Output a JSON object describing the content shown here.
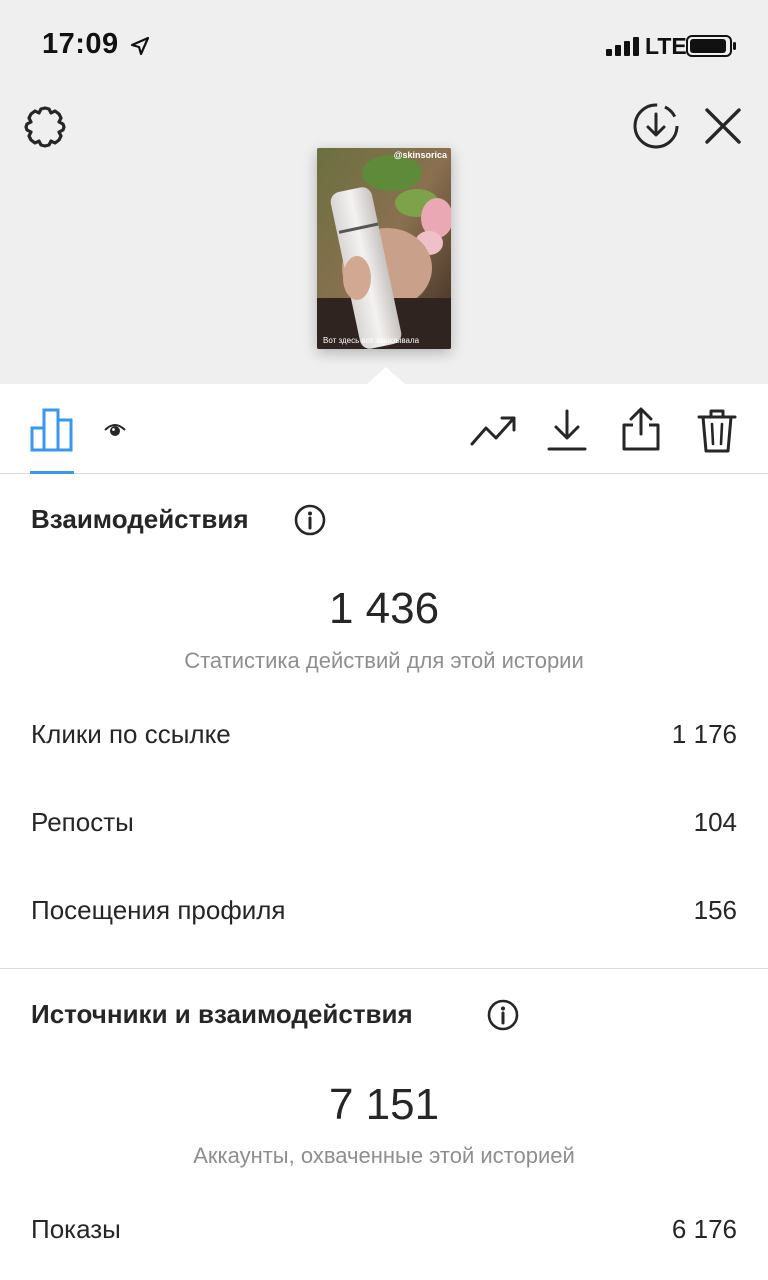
{
  "status_bar": {
    "time": "17:09",
    "carrier": "LTE"
  },
  "story": {
    "handle": "@skinsorica",
    "caption": "Вот здесь вот заказывала"
  },
  "colors": {
    "accent": "#3897f0",
    "text": "#262626",
    "secondary_text": "#8e8e8e",
    "top_background": "#efefef"
  },
  "icons": {
    "settings": "gear-icon",
    "download_circle": "download-circle-icon",
    "close": "close-icon",
    "stats": "bar-chart-icon",
    "viewers": "eye-icon",
    "promote": "trend-up-icon",
    "save": "download-icon",
    "share": "share-icon",
    "delete": "trash-icon",
    "info": "info-icon"
  },
  "interactions": {
    "title": "Взаимодействия",
    "total": "1 436",
    "caption": "Статистика действий для этой истории",
    "rows": [
      {
        "label": "Клики по ссылке",
        "value": "1 176"
      },
      {
        "label": "Репосты",
        "value": "104"
      },
      {
        "label": "Посещения профиля",
        "value": "156"
      }
    ]
  },
  "discovery": {
    "title": "Источники и взаимодействия",
    "total": "7 151",
    "caption": "Аккаунты, охваченные этой историей",
    "rows": [
      {
        "label": "Показы",
        "value": "6 176"
      }
    ]
  }
}
